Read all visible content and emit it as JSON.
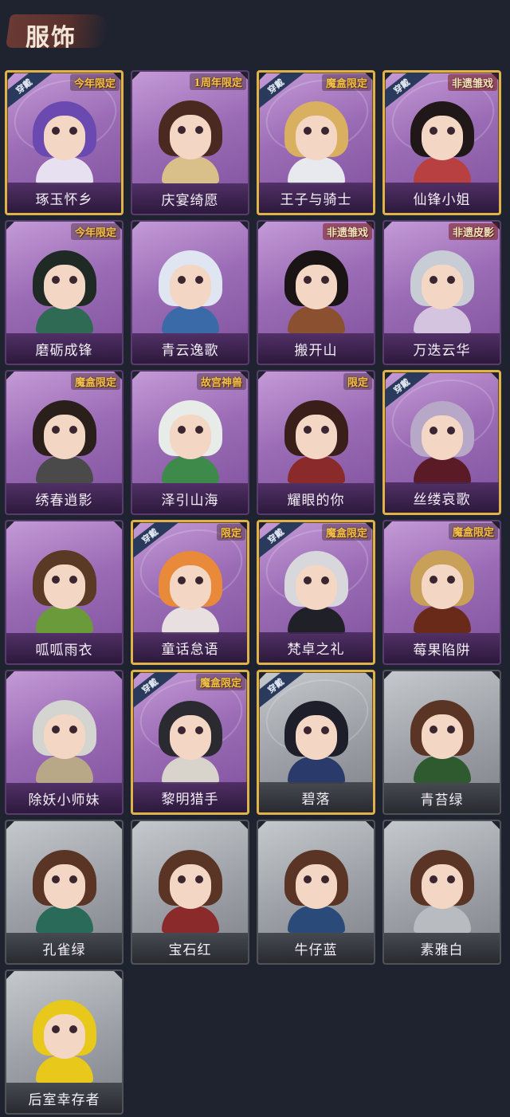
{
  "header": {
    "title": "服饰"
  },
  "worn_label": "穿戴",
  "outfits": [
    {
      "name": "琢玉怀乡",
      "badge": "今年限定",
      "worn": true,
      "tier": "purple",
      "hair": "#6a4ab0",
      "body": "#e6e0f0"
    },
    {
      "name": "庆宴绮愿",
      "badge": "1周年限定",
      "worn": false,
      "tier": "purple",
      "hair": "#4a2a20",
      "body": "#d9c08a"
    },
    {
      "name": "王子与骑士",
      "badge": "魔盒限定",
      "worn": true,
      "tier": "purple",
      "hair": "#d9b060",
      "body": "#e8e8ef"
    },
    {
      "name": "仙锋小姐",
      "badge": "非遗雏戏",
      "worn": true,
      "tier": "purple",
      "hair": "#201818",
      "body": "#b84040"
    },
    {
      "name": "磨砺成锋",
      "badge": "今年限定",
      "worn": false,
      "tier": "purple",
      "hair": "#1f2a24",
      "body": "#2f6a55"
    },
    {
      "name": "青云逸歌",
      "badge": "",
      "worn": false,
      "tier": "purple",
      "hair": "#dfe6f2",
      "body": "#3b6aa8"
    },
    {
      "name": "搬开山",
      "badge": "非遗雏戏",
      "worn": false,
      "tier": "purple",
      "hair": "#1b1414",
      "body": "#8a5030"
    },
    {
      "name": "万迭云华",
      "badge": "非遗皮影",
      "worn": false,
      "tier": "purple",
      "hair": "#c8ccd4",
      "body": "#d4c4e0"
    },
    {
      "name": "绣春逍影",
      "badge": "魔盒限定",
      "worn": false,
      "tier": "purple",
      "hair": "#2a1f1a",
      "body": "#4a4a4a"
    },
    {
      "name": "泽引山海",
      "badge": "故宫神兽",
      "worn": false,
      "tier": "purple",
      "hair": "#e8ece8",
      "body": "#3e8a4a"
    },
    {
      "name": "耀眼的你",
      "badge": "限定",
      "worn": false,
      "tier": "purple",
      "hair": "#3a1e1a",
      "body": "#8a2a2a"
    },
    {
      "name": "丝缕哀歌",
      "badge": "",
      "worn": true,
      "tier": "purple",
      "hair": "#b8a8c8",
      "body": "#5a1a26"
    },
    {
      "name": "呱呱雨衣",
      "badge": "",
      "worn": false,
      "tier": "purple",
      "hair": "#5a3a24",
      "body": "#6a9a3a"
    },
    {
      "name": "童话怠语",
      "badge": "限定",
      "worn": true,
      "tier": "purple",
      "hair": "#e88a3a",
      "body": "#e8e0e0"
    },
    {
      "name": "梵卓之礼",
      "badge": "魔盒限定",
      "worn": true,
      "tier": "purple",
      "hair": "#d8d8dc",
      "body": "#202028"
    },
    {
      "name": "莓果陷阱",
      "badge": "魔盒限定",
      "worn": false,
      "tier": "purple",
      "hair": "#c8a058",
      "body": "#6a2a1a"
    },
    {
      "name": "除妖小师妹",
      "badge": "",
      "worn": false,
      "tier": "purple",
      "hair": "#d4d4d0",
      "body": "#b8a888"
    },
    {
      "name": "黎明猎手",
      "badge": "魔盒限定",
      "worn": true,
      "tier": "purple",
      "hair": "#2a2a30",
      "body": "#d8d4cc"
    },
    {
      "name": "碧落",
      "badge": "",
      "worn": true,
      "tier": "gray",
      "hair": "#1e1e2a",
      "body": "#2a3a6a"
    },
    {
      "name": "青苔绿",
      "badge": "",
      "worn": false,
      "tier": "gray",
      "hair": "#5a3424",
      "body": "#2f5a30"
    },
    {
      "name": "孔雀绿",
      "badge": "",
      "worn": false,
      "tier": "gray",
      "hair": "#5a3424",
      "body": "#2a6a58"
    },
    {
      "name": "宝石红",
      "badge": "",
      "worn": false,
      "tier": "gray",
      "hair": "#5a3424",
      "body": "#8a2a2a"
    },
    {
      "name": "牛仔蓝",
      "badge": "",
      "worn": false,
      "tier": "gray",
      "hair": "#5a3424",
      "body": "#2a4a7a"
    },
    {
      "name": "素雅白",
      "badge": "",
      "worn": false,
      "tier": "gray",
      "hair": "#5a3424",
      "body": "#b8bcc0"
    },
    {
      "name": "后室幸存者",
      "badge": "",
      "worn": false,
      "tier": "gray",
      "hair": "#e8c81a",
      "body": "#e8c81a"
    }
  ]
}
